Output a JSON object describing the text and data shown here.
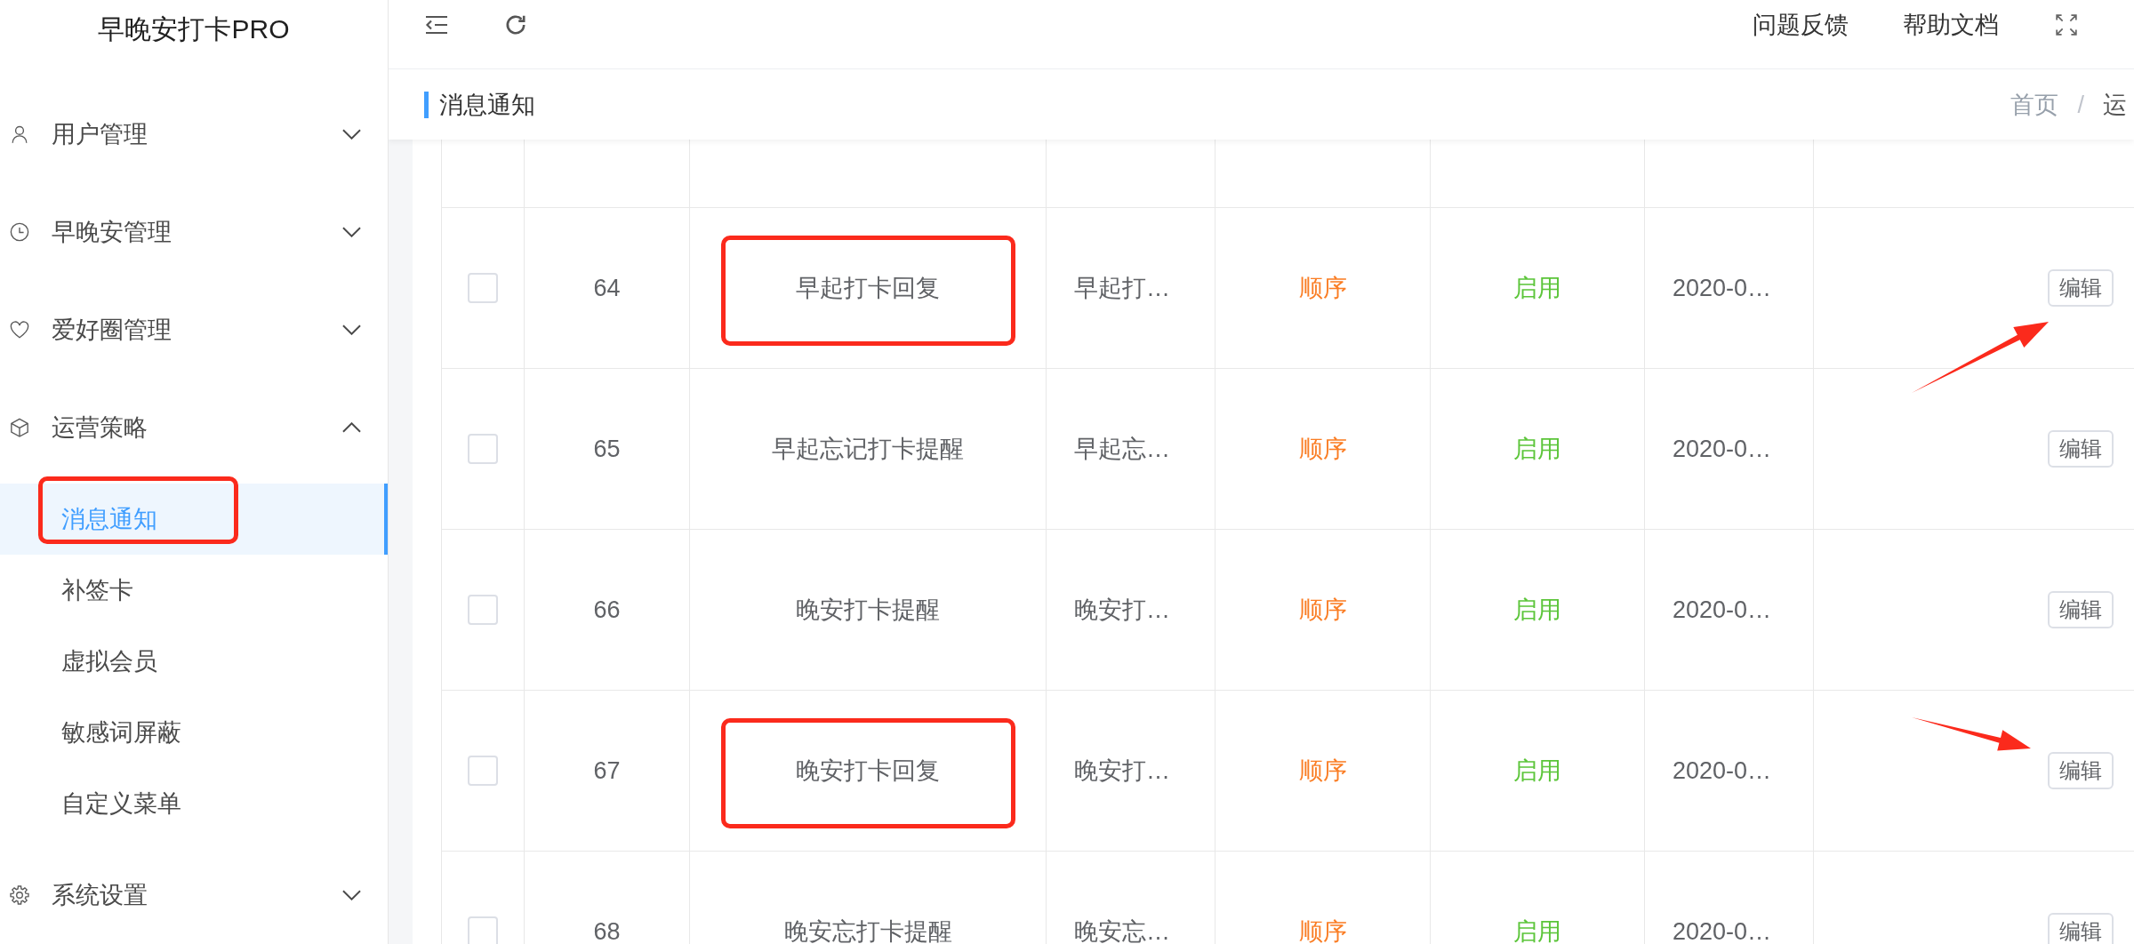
{
  "sidebar": {
    "title": "早晚安打卡PRO",
    "menu": [
      {
        "label": "用户管理",
        "expanded": false
      },
      {
        "label": "早晚安管理",
        "expanded": false
      },
      {
        "label": "爱好圈管理",
        "expanded": false
      },
      {
        "label": "运营策略",
        "expanded": true,
        "children": [
          {
            "label": "消息通知",
            "selected": true,
            "annotated": true
          },
          {
            "label": "补签卡",
            "selected": false,
            "annotated": false
          },
          {
            "label": "虚拟会员",
            "selected": false,
            "annotated": false
          },
          {
            "label": "敏感词屏蔽",
            "selected": false,
            "annotated": false
          },
          {
            "label": "自定义菜单",
            "selected": false,
            "annotated": false
          }
        ]
      },
      {
        "label": "系统设置",
        "expanded": false
      }
    ]
  },
  "top_bar": {
    "links": [
      "问题反馈",
      "帮助文档"
    ]
  },
  "page_title": "消息通知",
  "breadcrumb": {
    "items": [
      "首页",
      "运"
    ],
    "separator": "/"
  },
  "table": {
    "rows": [
      {
        "checked": false,
        "column_2": "64",
        "column_3": "早起打卡回复",
        "column_4": "早起打…",
        "column_5": "顺序",
        "column_6": "启用",
        "column_7": "2020-0…",
        "action": "编辑",
        "annotated": true,
        "arrow_rising": true,
        "arrow_falling": false
      },
      {
        "checked": false,
        "column_2": "65",
        "column_3": "早起忘记打卡提醒",
        "column_4": "早起忘…",
        "column_5": "顺序",
        "column_6": "启用",
        "column_7": "2020-0…",
        "action": "编辑",
        "annotated": false,
        "arrow_rising": false,
        "arrow_falling": false
      },
      {
        "checked": false,
        "column_2": "66",
        "column_3": "晚安打卡提醒",
        "column_4": "晚安打…",
        "column_5": "顺序",
        "column_6": "启用",
        "column_7": "2020-0…",
        "action": "编辑",
        "annotated": false,
        "arrow_rising": false,
        "arrow_falling": false
      },
      {
        "checked": false,
        "column_2": "67",
        "column_3": "晚安打卡回复",
        "column_4": "晚安打…",
        "column_5": "顺序",
        "column_6": "启用",
        "column_7": "2020-0…",
        "action": "编辑",
        "annotated": true,
        "arrow_rising": false,
        "arrow_falling": true
      },
      {
        "checked": false,
        "column_2": "68",
        "column_3": "晚安忘打卡提醒",
        "column_4": "晚安忘…",
        "column_5": "顺序",
        "column_6": "启用",
        "column_7": "2020-0…",
        "action": "编辑",
        "annotated": false,
        "arrow_rising": false,
        "arrow_falling": false
      }
    ]
  }
}
